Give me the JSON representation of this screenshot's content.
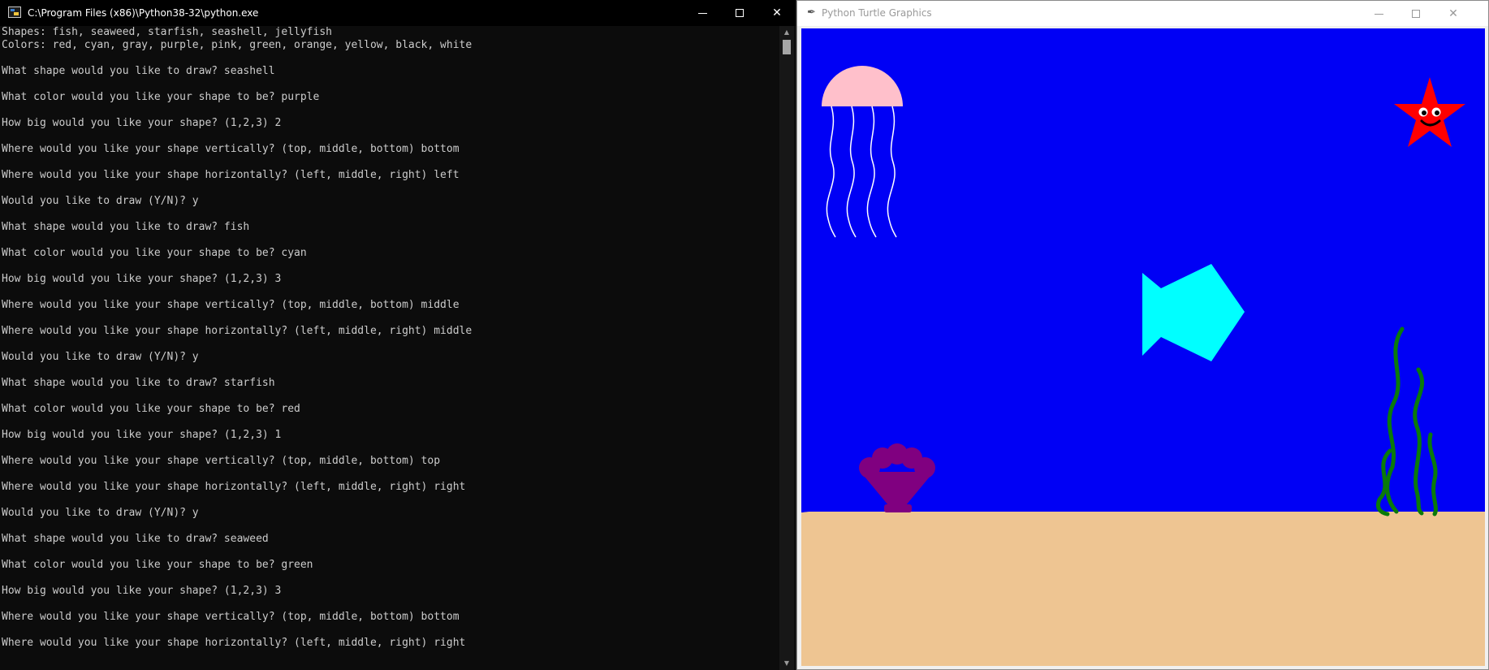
{
  "console": {
    "title": "C:\\Program Files (x86)\\Python38-32\\python.exe",
    "lines": [
      "Shapes: fish, seaweed, starfish, seashell, jellyfish",
      "Colors: red, cyan, gray, purple, pink, green, orange, yellow, black, white",
      "What shape would you like to draw? seashell",
      "What color would you like your shape to be? purple",
      "How big would you like your shape? (1,2,3) 2",
      "Where would you like your shape vertically? (top, middle, bottom) bottom",
      "Where would you like your shape horizontally? (left, middle, right) left",
      "Would you like to draw (Y/N)? y",
      "What shape would you like to draw? fish",
      "What color would you like your shape to be? cyan",
      "How big would you like your shape? (1,2,3) 3",
      "Where would you like your shape vertically? (top, middle, bottom) middle",
      "Where would you like your shape horizontally? (left, middle, right) middle",
      "Would you like to draw (Y/N)? y",
      "What shape would you like to draw? starfish",
      "What color would you like your shape to be? red",
      "How big would you like your shape? (1,2,3) 1",
      "Where would you like your shape vertically? (top, middle, bottom) top",
      "Where would you like your shape horizontally? (left, middle, right) right",
      "Would you like to draw (Y/N)? y",
      "What shape would you like to draw? seaweed",
      "What color would you like your shape to be? green",
      "How big would you like your shape? (1,2,3) 3",
      "Where would you like your shape vertically? (top, middle, bottom) bottom",
      "Where would you like your shape horizontally? (left, middle, right) right"
    ]
  },
  "turtle_window": {
    "title": "Python Turtle Graphics",
    "scene": {
      "water_color": "#0000f5",
      "sand_color": "#eec592",
      "shapes": [
        {
          "shape": "jellyfish",
          "color": "pink",
          "hex": "#ffc0cb",
          "size": null,
          "vertical": "top",
          "horizontal": "left"
        },
        {
          "shape": "starfish",
          "color": "red",
          "hex": "#ff0000",
          "size": 1,
          "vertical": "top",
          "horizontal": "right"
        },
        {
          "shape": "fish",
          "color": "cyan",
          "hex": "#00ffff",
          "size": 3,
          "vertical": "middle",
          "horizontal": "middle"
        },
        {
          "shape": "seashell",
          "color": "purple",
          "hex": "#800080",
          "size": 2,
          "vertical": "bottom",
          "horizontal": "left"
        },
        {
          "shape": "seaweed",
          "color": "green",
          "hex": "#0a7a0a",
          "size": 3,
          "vertical": "bottom",
          "horizontal": "right"
        }
      ]
    }
  },
  "icons": {
    "console_app": "console-app-icon",
    "turtle_app": "feather-icon"
  }
}
